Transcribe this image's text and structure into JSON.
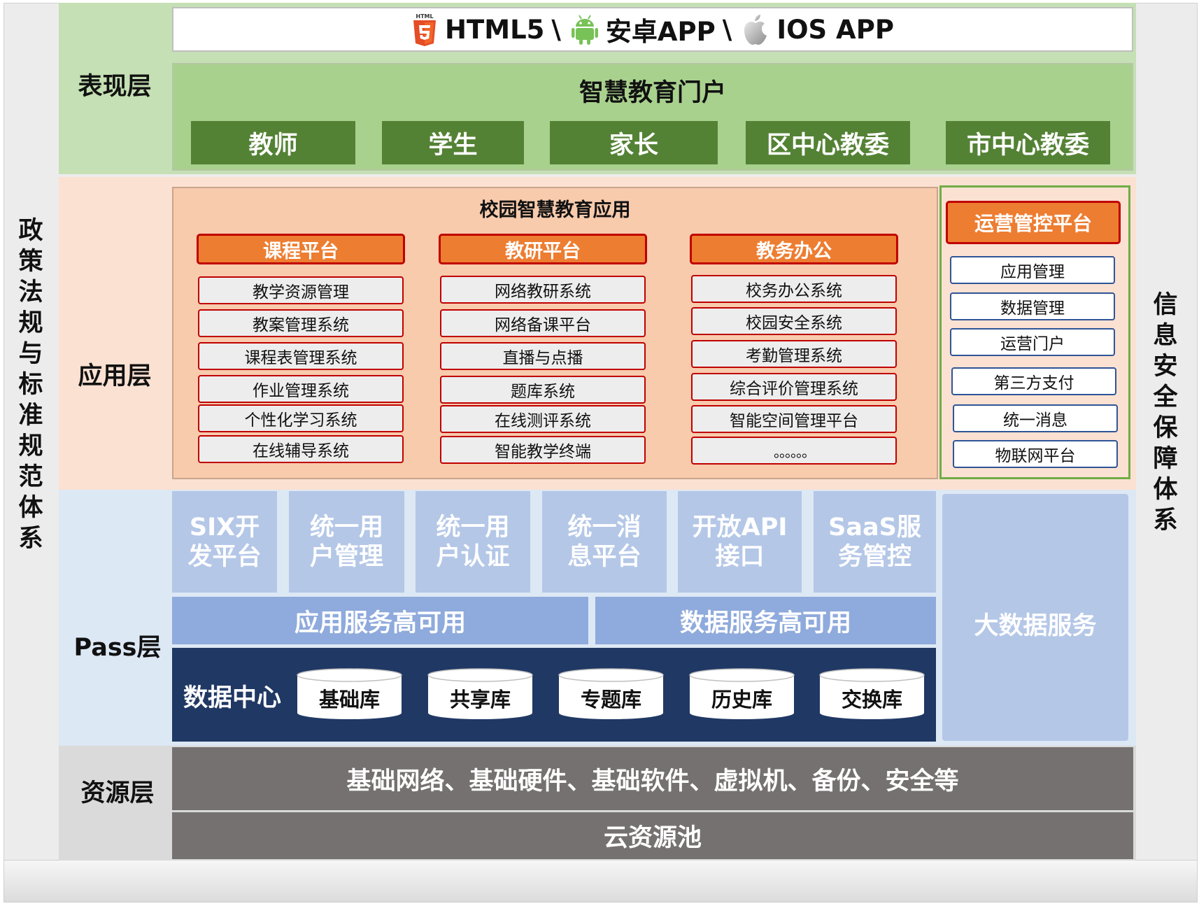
{
  "side": {
    "left": "政策法规与标准规范体系",
    "right": "信息安全保障体系"
  },
  "layers": {
    "presentation": "表现层",
    "application": "应用层",
    "pass": "Pass层",
    "resource": "资源层"
  },
  "clients": {
    "html5_badge": "HTML",
    "html5": "HTML5",
    "sep1": "\\",
    "android": "安卓APP",
    "sep2": "\\",
    "ios": "IOS APP"
  },
  "portal": {
    "title": "智慧教育门户",
    "roles": [
      "教师",
      "学生",
      "家长",
      "区中心教委",
      "市中心教委"
    ]
  },
  "campus": {
    "title": "校园智慧教育应用",
    "categories": [
      {
        "name": "课程平台",
        "items": [
          "教学资源管理",
          "教案管理系统",
          "课程表管理系统",
          "作业管理系统",
          "个性化学习系统",
          "在线辅导系统"
        ]
      },
      {
        "name": "教研平台",
        "items": [
          "网络教研系统",
          "网络备课平台",
          "直播与点播",
          "题库系统",
          "在线测评系统",
          "智能教学终端"
        ]
      },
      {
        "name": "教务办公",
        "items": [
          "校务办公系统",
          "校园安全系统",
          "考勤管理系统",
          "综合评价管理系统",
          "智能空间管理平台",
          "。。。。。。"
        ]
      }
    ]
  },
  "ops": {
    "title": "运营管控平台",
    "items": [
      "应用管理",
      "数据管理",
      "运营门户",
      "第三方支付",
      "统一消息",
      "物联网平台"
    ]
  },
  "pass": {
    "services": [
      [
        "SIX开",
        "发平台"
      ],
      [
        "统一用",
        "户管理"
      ],
      [
        "统一用",
        "户认证"
      ],
      [
        "统一消",
        "息平台"
      ],
      [
        "开放API",
        "接口"
      ],
      [
        "SaaS服",
        "务管控"
      ]
    ],
    "app_ha": "应用服务高可用",
    "data_ha": "数据服务高可用",
    "bigdata": "大数据服务",
    "datacenter": "数据中心",
    "databases": [
      "基础库",
      "共享库",
      "专题库",
      "历史库",
      "交换库"
    ]
  },
  "resource": {
    "infra": "基础网络、基础硬件、基础软件、虚拟机、备份、安全等",
    "cloud": "云资源池"
  },
  "colors": {
    "role_green": "#548235",
    "category_orange": "#ed7d31",
    "border_red": "#c00000",
    "navy": "#203864",
    "service_blue": "#b4c7e7",
    "ha_blue": "#8faadc",
    "resource_gray": "#767171"
  }
}
